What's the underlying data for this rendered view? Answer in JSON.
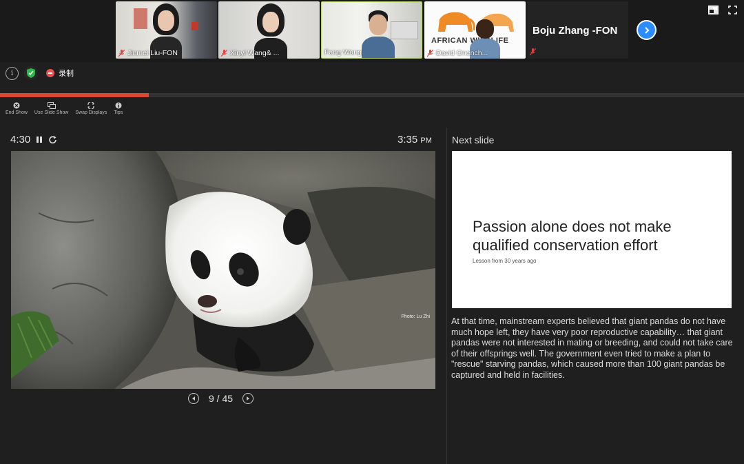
{
  "participants": [
    {
      "name": "Jinmei Liu-FON"
    },
    {
      "name": "Xinyi Wang& ..."
    },
    {
      "name": "Fang Wang"
    },
    {
      "name": "David Onench..."
    }
  ],
  "logo_text": "AFRICAN WILDLIFE",
  "active_speaker": "Boju Zhang -FON",
  "recording_label": "录制",
  "toolbar": {
    "end_show": "End Show",
    "use_slide_show": "Use Slide Show",
    "swap_displays": "Swap Displays",
    "tips": "Tips"
  },
  "presentation": {
    "progress": 0.2,
    "elapsed": "4:30",
    "clock_time": "3:35",
    "clock_period": "PM",
    "photo_credit": "Photo: Lu Zhi",
    "page_indicator": "9 / 45"
  },
  "next_slide": {
    "label": "Next slide",
    "title": "Passion alone does not make qualified conservation effort",
    "subtitle": "Lesson from 30 years ago"
  },
  "notes": "At that time, mainstream experts believed that giant pandas do not have much hope left, they have very poor reproductive capability… that giant pandas were not interested in mating or breeding, and could not take care of their offsprings well. The government even tried to make a plan to \"rescue\" starving pandas, which caused more than 100 giant pandas be captured and held in facilities.",
  "colors": {
    "progress": "#d9492e",
    "accent": "#2d8cff",
    "logo_orange": "#f08a24"
  }
}
